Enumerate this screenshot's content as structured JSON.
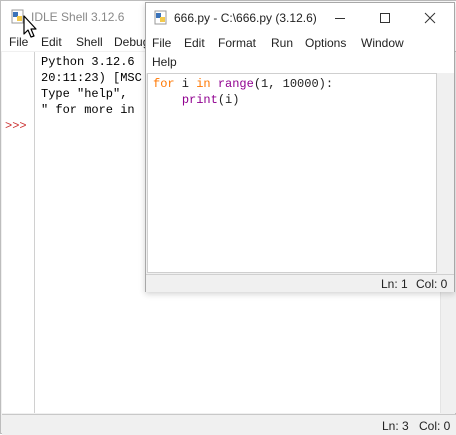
{
  "shell": {
    "title": "IDLE Shell 3.12.6",
    "menu": [
      "File",
      "Edit",
      "Shell",
      "Debug"
    ],
    "prompt": ">>>",
    "lines": [
      "Python 3.12.6",
      "20:11:23) [MSC",
      "Type \"help\",",
      "\" for more in"
    ],
    "status": {
      "ln": "Ln: 3",
      "col": "Col: 0"
    }
  },
  "editor": {
    "title": "666.py - C:\\666.py (3.12.6)",
    "menu": [
      "File",
      "Edit",
      "Format",
      "Run",
      "Options",
      "Window",
      "Help"
    ],
    "code": {
      "line1": {
        "kw_for": "for",
        "var": " i ",
        "kw_in": "in",
        "sp": " ",
        "builtin": "range",
        "rest": "(1, 10000):"
      },
      "line2": {
        "indent": "    ",
        "builtin": "print",
        "rest": "(i)"
      }
    },
    "status": {
      "ln": "Ln: 1",
      "col": "Col: 0"
    }
  },
  "icons": {
    "app": "python-idle-icon",
    "minimize": "minimize-icon",
    "maximize": "maximize-icon",
    "close": "close-icon",
    "cursor": "mouse-pointer-icon"
  }
}
